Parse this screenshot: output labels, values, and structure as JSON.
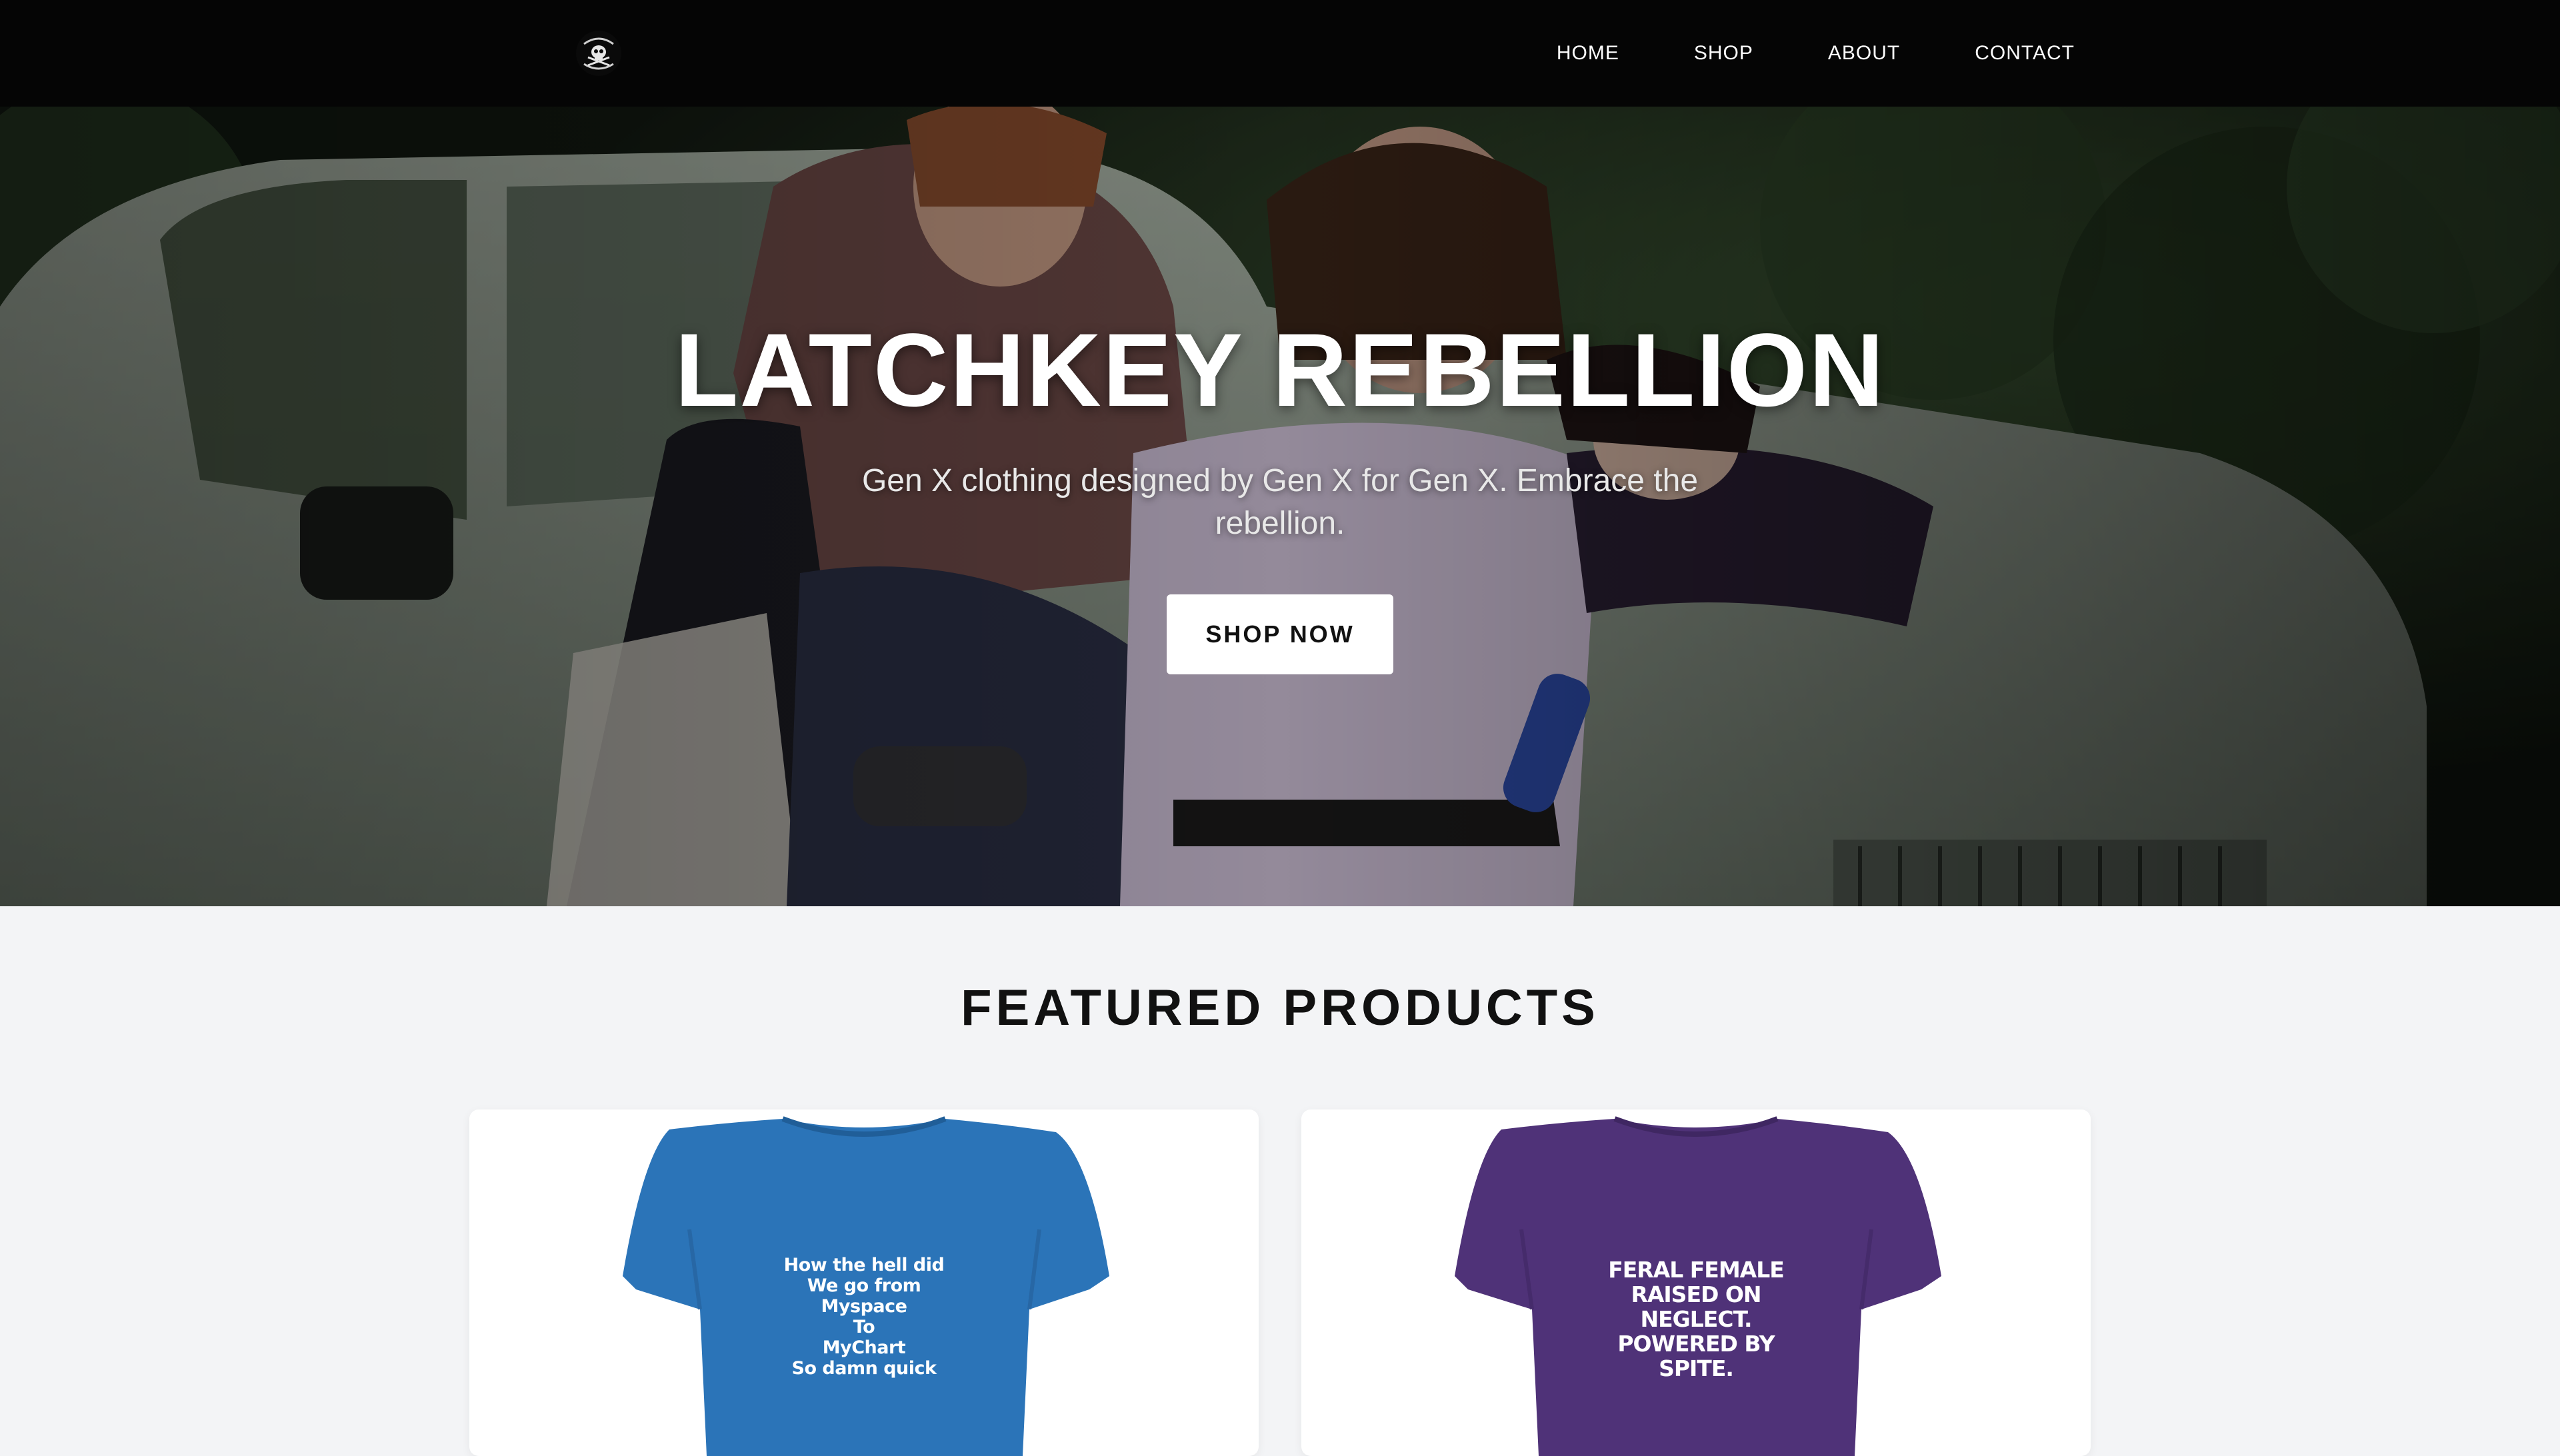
{
  "nav": {
    "links": [
      "HOME",
      "SHOP",
      "ABOUT",
      "CONTACT"
    ]
  },
  "hero": {
    "title": "LATCHKEY REBELLION",
    "subtitle": "Gen X clothing designed by Gen X for Gen X. Embrace the rebellion.",
    "cta_label": "SHOP NOW"
  },
  "featured": {
    "title": "FEATURED PRODUCTS",
    "products": [
      {
        "shirt_color": "#2b74b8",
        "print_text": "How the hell did\nWe go from\nMyspace\nTo\nMyChart\nSo damn quick"
      },
      {
        "shirt_color": "#4f3278",
        "print_text": "FERAL FEMALE\nRAISED ON\nNEGLECT.\nPOWERED BY\nSPITE."
      }
    ]
  },
  "colors": {
    "nav_bg": "#050505",
    "page_bg": "#f3f4f6",
    "button_bg": "#ffffff",
    "text_dark": "#111111"
  },
  "icons": {
    "logo": "skull-crossbones-logo-icon"
  }
}
